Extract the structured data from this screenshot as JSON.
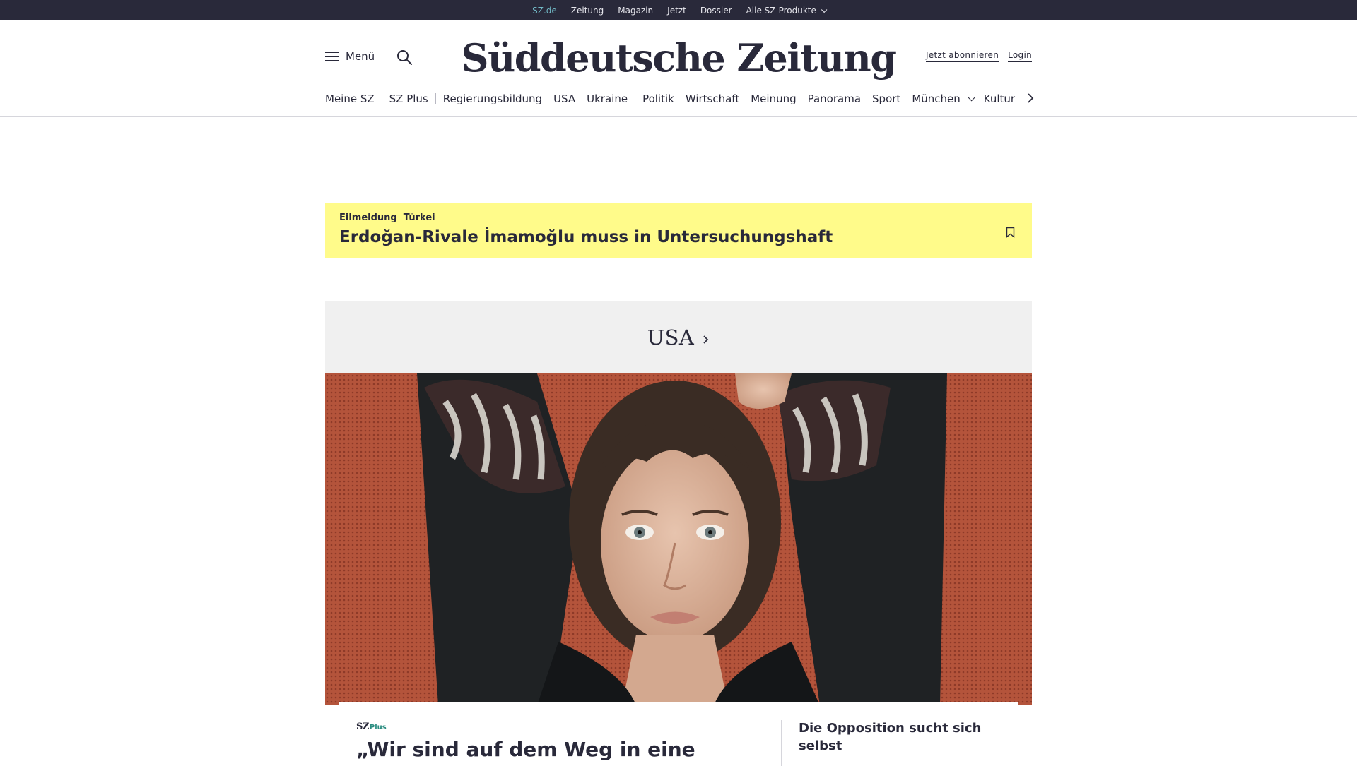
{
  "topbar": {
    "items": [
      "SZ.de",
      "Zeitung",
      "Magazin",
      "Jetzt",
      "Dossier",
      "Alle SZ-Produkte"
    ]
  },
  "header": {
    "menu_label": "Menü",
    "logo_text": "Süddeutsche Zeitung",
    "subscribe_label": "Jetzt abonnieren",
    "login_label": "Login"
  },
  "section_nav": {
    "items": [
      "Meine SZ",
      "SZ Plus",
      "Regierungsbildung",
      "USA",
      "Ukraine",
      "Politik",
      "Wirtschaft",
      "Meinung",
      "Panorama",
      "Sport",
      "München",
      "Kultur"
    ]
  },
  "breaking": {
    "label": "Eilmeldung",
    "topic": "Türkei",
    "headline": "Erdoğan-Rivale İmamoğlu muss in Untersuchungshaft"
  },
  "usa_section": {
    "title": "USA"
  },
  "teaser": {
    "badge_sz": "SZ",
    "badge_plus": "Plus",
    "headline": "„Wir sind auf dem Weg in eine",
    "side_headline": "Die Opposition sucht sich selbst"
  },
  "icons": {
    "menu": "hamburger-icon",
    "search": "search-icon",
    "bookmark": "bookmark-icon",
    "chevron": "chevron-right-icon"
  },
  "colors": {
    "dark": "#29293a",
    "breaking_bg": "#fffb8a",
    "active_link": "#71b8c5",
    "plus_green": "#2a8d80"
  }
}
